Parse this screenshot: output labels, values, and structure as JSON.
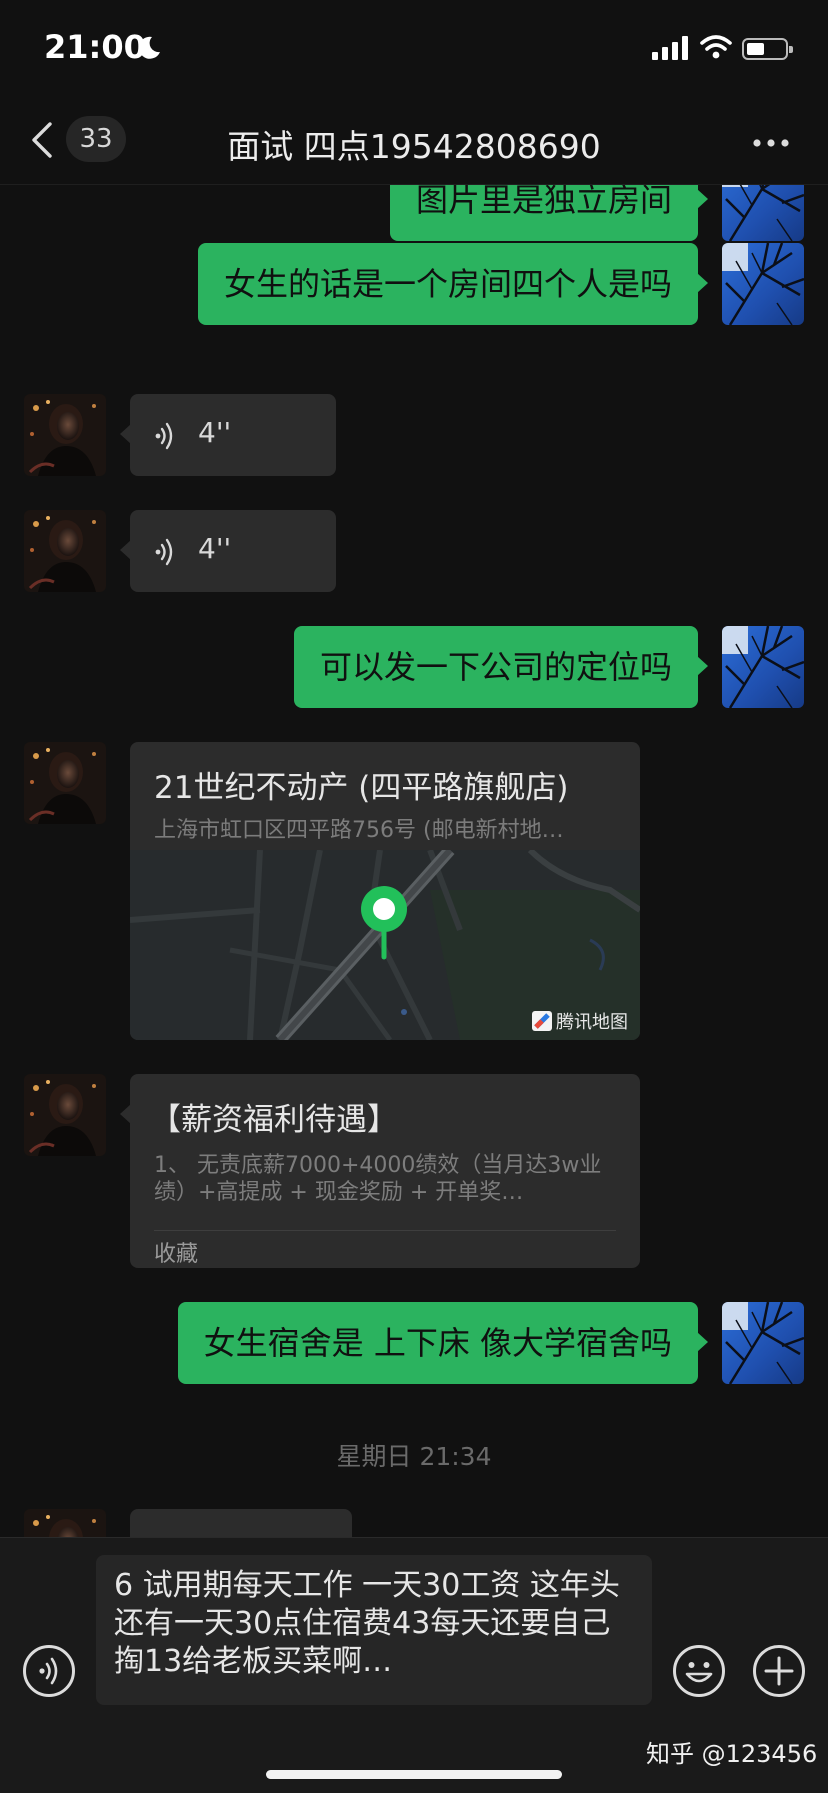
{
  "status_bar": {
    "time": "21:00"
  },
  "nav": {
    "unread_count": "33",
    "title": "面试 四点19542808690"
  },
  "messages": {
    "m1": "图片里是独立房间",
    "m2": "女生的话是一个房间四个人是吗",
    "v1": "4''",
    "v2": "4''",
    "m3": "可以发一下公司的定位吗",
    "location": {
      "title": "21世纪不动产 (四平路旗舰店)",
      "address": "上海市虹口区四平路756号 (邮电新村地…",
      "map_brand": "腾讯地图"
    },
    "card": {
      "title": "【薪资福利待遇】",
      "desc": "1、 无责底薪7000+4000绩效（当月达3w业绩）+高提成 + 现金奖励 + 开单奖…",
      "source": "收藏"
    },
    "m4": "女生宿舍是 上下床 像大学宿舍吗",
    "timestamp": "星期日 21:34"
  },
  "composer": {
    "draft": "6  试用期每天工作 一天30工资 这年头还有一天30点住宿费43每天还要自己掏13给老板买菜啊…"
  },
  "watermark": "知乎 @123456",
  "colors": {
    "background": "#111111",
    "my_bubble": "#2bb35f",
    "their_bubble": "#2c2c2c",
    "pin": "#22c05a"
  }
}
